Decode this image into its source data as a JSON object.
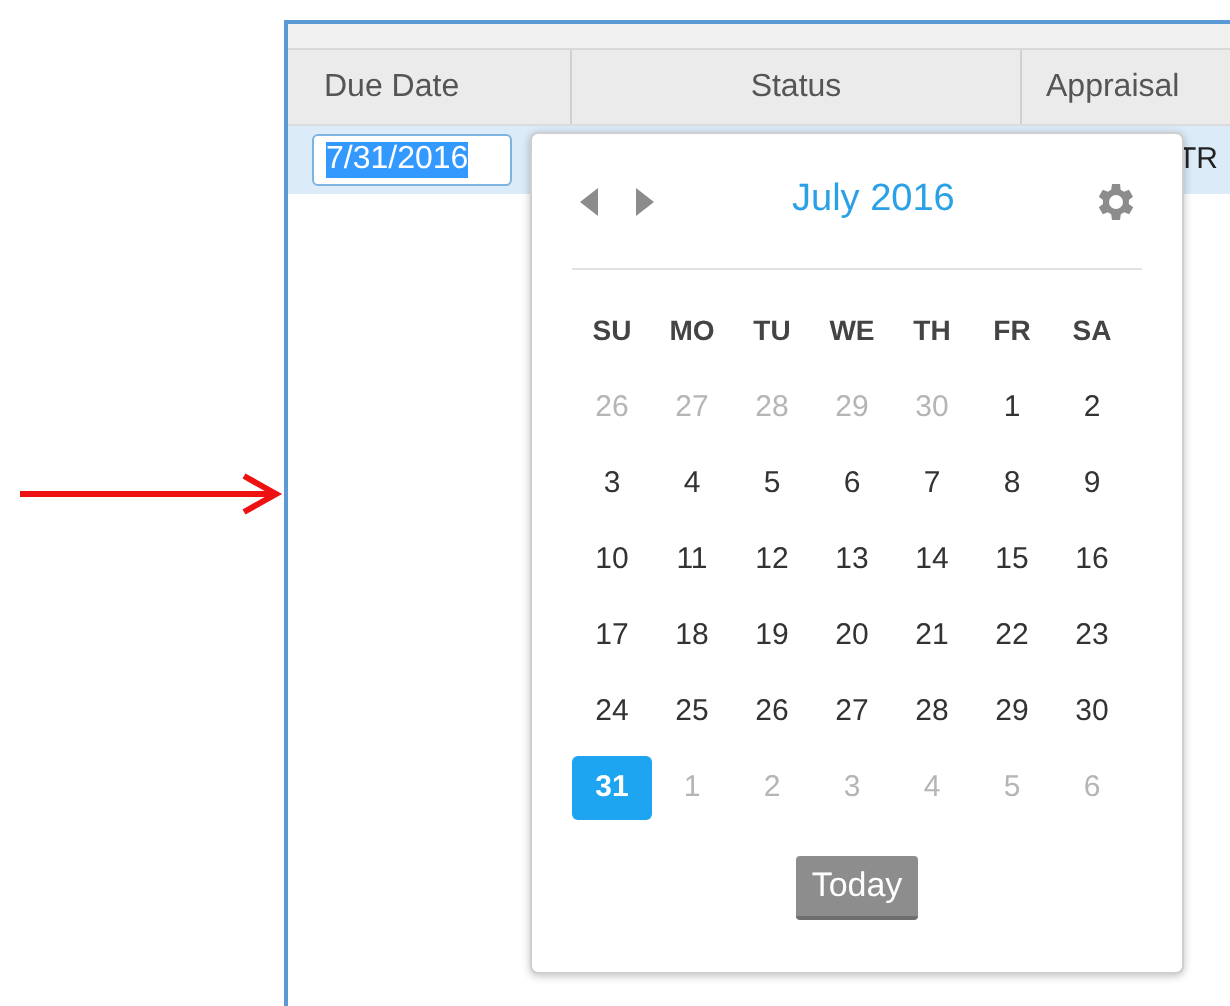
{
  "grid": {
    "columns": [
      "Due Date",
      "Status",
      "Appraisal"
    ],
    "row": {
      "due_date": "7/31/2016",
      "column_3": "TR",
      "selected": true
    }
  },
  "datepicker": {
    "title": "July 2016",
    "weekdays": [
      "SU",
      "MO",
      "TU",
      "WE",
      "TH",
      "FR",
      "SA"
    ],
    "weeks": [
      [
        {
          "label": "26",
          "other_month": true,
          "selected": false
        },
        {
          "label": "27",
          "other_month": true,
          "selected": false
        },
        {
          "label": "28",
          "other_month": true,
          "selected": false
        },
        {
          "label": "29",
          "other_month": true,
          "selected": false
        },
        {
          "label": "30",
          "other_month": true,
          "selected": false
        },
        {
          "label": "1",
          "other_month": false,
          "selected": false
        },
        {
          "label": "2",
          "other_month": false,
          "selected": false
        }
      ],
      [
        {
          "label": "3",
          "other_month": false,
          "selected": false
        },
        {
          "label": "4",
          "other_month": false,
          "selected": false
        },
        {
          "label": "5",
          "other_month": false,
          "selected": false
        },
        {
          "label": "6",
          "other_month": false,
          "selected": false
        },
        {
          "label": "7",
          "other_month": false,
          "selected": false
        },
        {
          "label": "8",
          "other_month": false,
          "selected": false
        },
        {
          "label": "9",
          "other_month": false,
          "selected": false
        }
      ],
      [
        {
          "label": "10",
          "other_month": false,
          "selected": false
        },
        {
          "label": "11",
          "other_month": false,
          "selected": false
        },
        {
          "label": "12",
          "other_month": false,
          "selected": false
        },
        {
          "label": "13",
          "other_month": false,
          "selected": false
        },
        {
          "label": "14",
          "other_month": false,
          "selected": false
        },
        {
          "label": "15",
          "other_month": false,
          "selected": false
        },
        {
          "label": "16",
          "other_month": false,
          "selected": false
        }
      ],
      [
        {
          "label": "17",
          "other_month": false,
          "selected": false
        },
        {
          "label": "18",
          "other_month": false,
          "selected": false
        },
        {
          "label": "19",
          "other_month": false,
          "selected": false
        },
        {
          "label": "20",
          "other_month": false,
          "selected": false
        },
        {
          "label": "21",
          "other_month": false,
          "selected": false
        },
        {
          "label": "22",
          "other_month": false,
          "selected": false
        },
        {
          "label": "23",
          "other_month": false,
          "selected": false
        }
      ],
      [
        {
          "label": "24",
          "other_month": false,
          "selected": false
        },
        {
          "label": "25",
          "other_month": false,
          "selected": false
        },
        {
          "label": "26",
          "other_month": false,
          "selected": false
        },
        {
          "label": "27",
          "other_month": false,
          "selected": false
        },
        {
          "label": "28",
          "other_month": false,
          "selected": false
        },
        {
          "label": "29",
          "other_month": false,
          "selected": false
        },
        {
          "label": "30",
          "other_month": false,
          "selected": false
        }
      ],
      [
        {
          "label": "31",
          "other_month": false,
          "selected": true
        },
        {
          "label": "1",
          "other_month": true,
          "selected": false
        },
        {
          "label": "2",
          "other_month": true,
          "selected": false
        },
        {
          "label": "3",
          "other_month": true,
          "selected": false
        },
        {
          "label": "4",
          "other_month": true,
          "selected": false
        },
        {
          "label": "5",
          "other_month": true,
          "selected": false
        },
        {
          "label": "6",
          "other_month": true,
          "selected": false
        }
      ]
    ],
    "today_button": "Today"
  }
}
